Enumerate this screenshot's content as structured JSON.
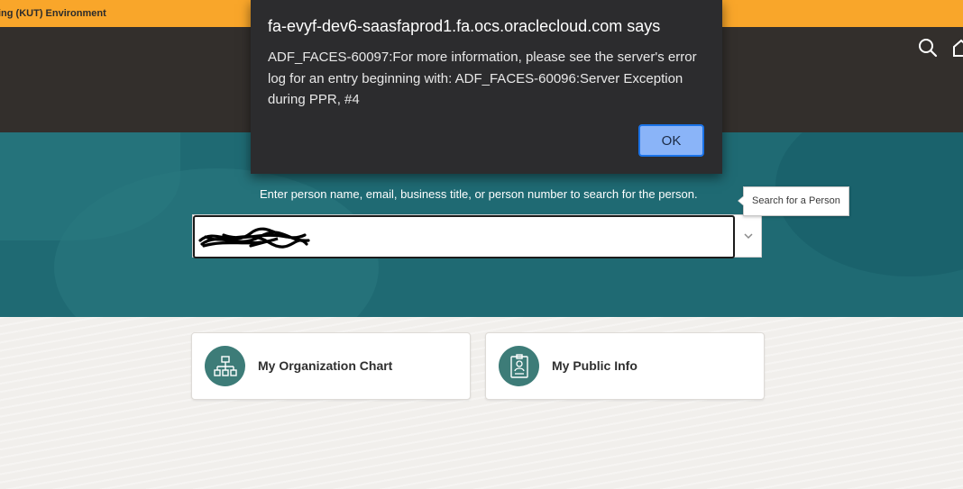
{
  "environment_banner": {
    "text": "ing (KUT) Environment"
  },
  "header": {
    "icons": [
      "search-icon",
      "home-icon"
    ],
    "colors": {
      "banner": "#f9a62a",
      "header_bg": "#332f2c"
    }
  },
  "search": {
    "hint": "Enter person name, email, business title, or person number to search for the person.",
    "value": "",
    "tooltip": "Search for a Person",
    "dropdown_icon": "chevron-down-icon"
  },
  "cards": [
    {
      "label": "My Organization Chart",
      "icon": "org-chart-icon"
    },
    {
      "label": "My Public Info",
      "icon": "badge-icon"
    }
  ],
  "dialog": {
    "title": "fa-evyf-dev6-saasfaprod1.fa.ocs.oraclecloud.com says",
    "message": "ADF_FACES-60097:For more information, please see the server's error log for an entry beginning with: ADF_FACES-60096:Server Exception during PPR, #4",
    "ok_label": "OK"
  },
  "colors": {
    "hero": "#1f6a73",
    "card_icon": "#3d7c78",
    "dialog_bg": "#2c2c2e",
    "ok_button": "#8ab4f8"
  }
}
